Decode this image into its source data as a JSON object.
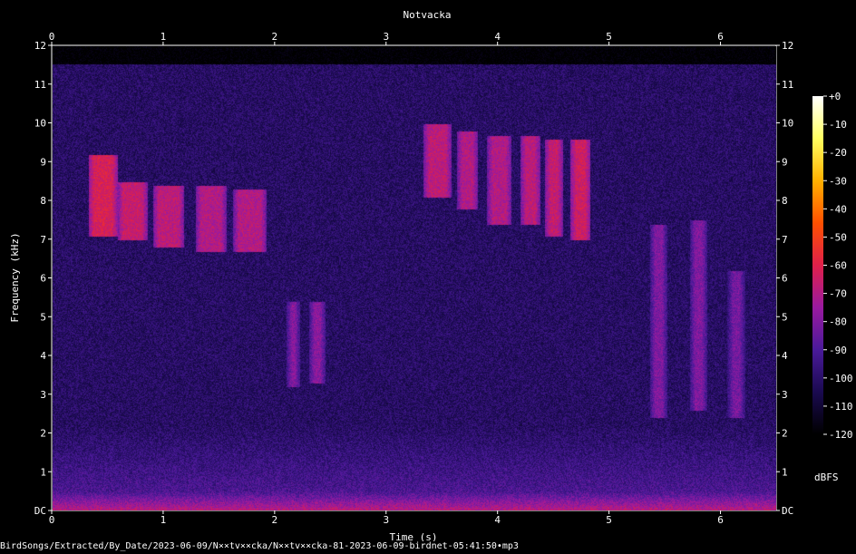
{
  "chart_data": {
    "type": "heatmap",
    "title": "Notvacka",
    "xlabel": "Time (s)",
    "ylabel": "Frequency (kHz)",
    "xlim": [
      0,
      6.5
    ],
    "ylim": [
      0,
      12
    ],
    "x_ticks": [
      "0",
      "1",
      "2",
      "3",
      "4",
      "5",
      "6"
    ],
    "y_ticks": [
      "DC",
      "1",
      "2",
      "3",
      "4",
      "5",
      "6",
      "7",
      "8",
      "9",
      "10",
      "11",
      "12"
    ],
    "colorbar": {
      "label": "dBFS",
      "range": [
        -120,
        0
      ],
      "ticks": [
        "+0",
        "-10",
        "-20",
        "-30",
        "-40",
        "-50",
        "-60",
        "-70",
        "-80",
        "-90",
        "-100",
        "-110",
        "-120"
      ],
      "colors": [
        "#000000",
        "#1a0a50",
        "#4a1a9a",
        "#9a1aa0",
        "#e0204a",
        "#ff5000",
        "#ffb000",
        "#ffff60",
        "#ffffff"
      ]
    },
    "events": [
      {
        "t0": 0.32,
        "t1": 0.58,
        "f_low": 7.1,
        "f_high": 9.2,
        "db": -62
      },
      {
        "t0": 0.58,
        "t1": 0.85,
        "f_low": 7.0,
        "f_high": 8.5,
        "db": -66
      },
      {
        "t0": 0.9,
        "t1": 1.18,
        "f_low": 6.8,
        "f_high": 8.4,
        "db": -68
      },
      {
        "t0": 1.28,
        "t1": 1.56,
        "f_low": 6.7,
        "f_high": 8.4,
        "db": -70
      },
      {
        "t0": 1.62,
        "t1": 1.92,
        "f_low": 6.7,
        "f_high": 8.3,
        "db": -70
      },
      {
        "t0": 2.1,
        "t1": 2.22,
        "f_low": 3.2,
        "f_high": 5.4,
        "db": -78
      },
      {
        "t0": 2.3,
        "t1": 2.45,
        "f_low": 3.3,
        "f_high": 5.4,
        "db": -78
      },
      {
        "t0": 3.33,
        "t1": 3.58,
        "f_low": 8.1,
        "f_high": 10.0,
        "db": -68
      },
      {
        "t0": 3.63,
        "t1": 3.82,
        "f_low": 7.8,
        "f_high": 9.8,
        "db": -70
      },
      {
        "t0": 3.9,
        "t1": 4.12,
        "f_low": 7.4,
        "f_high": 9.7,
        "db": -70
      },
      {
        "t0": 4.2,
        "t1": 4.38,
        "f_low": 7.4,
        "f_high": 9.7,
        "db": -68
      },
      {
        "t0": 4.42,
        "t1": 4.58,
        "f_low": 7.1,
        "f_high": 9.6,
        "db": -66
      },
      {
        "t0": 4.65,
        "t1": 4.83,
        "f_low": 7.0,
        "f_high": 9.6,
        "db": -64
      },
      {
        "t0": 5.36,
        "t1": 5.52,
        "f_low": 2.4,
        "f_high": 7.4,
        "db": -80
      },
      {
        "t0": 5.72,
        "t1": 5.88,
        "f_low": 2.6,
        "f_high": 7.5,
        "db": -80
      },
      {
        "t0": 6.06,
        "t1": 6.22,
        "f_low": 2.4,
        "f_high": 6.2,
        "db": -82
      }
    ]
  },
  "footer": {
    "path": "BirdSongs/Extracted/By_Date/2023-06-09/N××tv××cka/N××tv××cka-81-2023-06-09-birdnet-05:41:50•mp3"
  }
}
